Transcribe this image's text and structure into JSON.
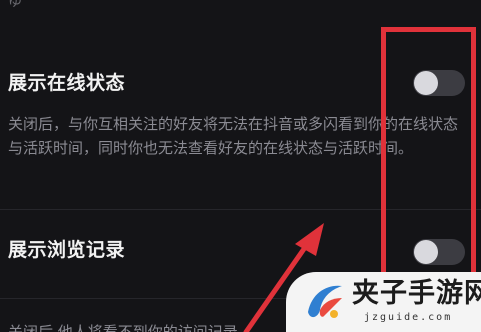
{
  "settings": {
    "top_partial_text": "ゆ",
    "online_status": {
      "title": "展示在线状态",
      "description": "关闭后，与你互相关注的好友将无法在抖音或多闪看到你的在线状态与活跃时间，同时你也无法查看好友的在线状态与活跃时间。",
      "enabled": false
    },
    "browse_history": {
      "title": "展示浏览记录",
      "enabled": false
    },
    "bottom_partial_text": "关闭后 他人将看不到你的访问记录"
  },
  "annotation": {
    "highlight_color": "#e0323a"
  },
  "watermark": {
    "name": "夹子手游网",
    "url": "jzguide.com"
  }
}
